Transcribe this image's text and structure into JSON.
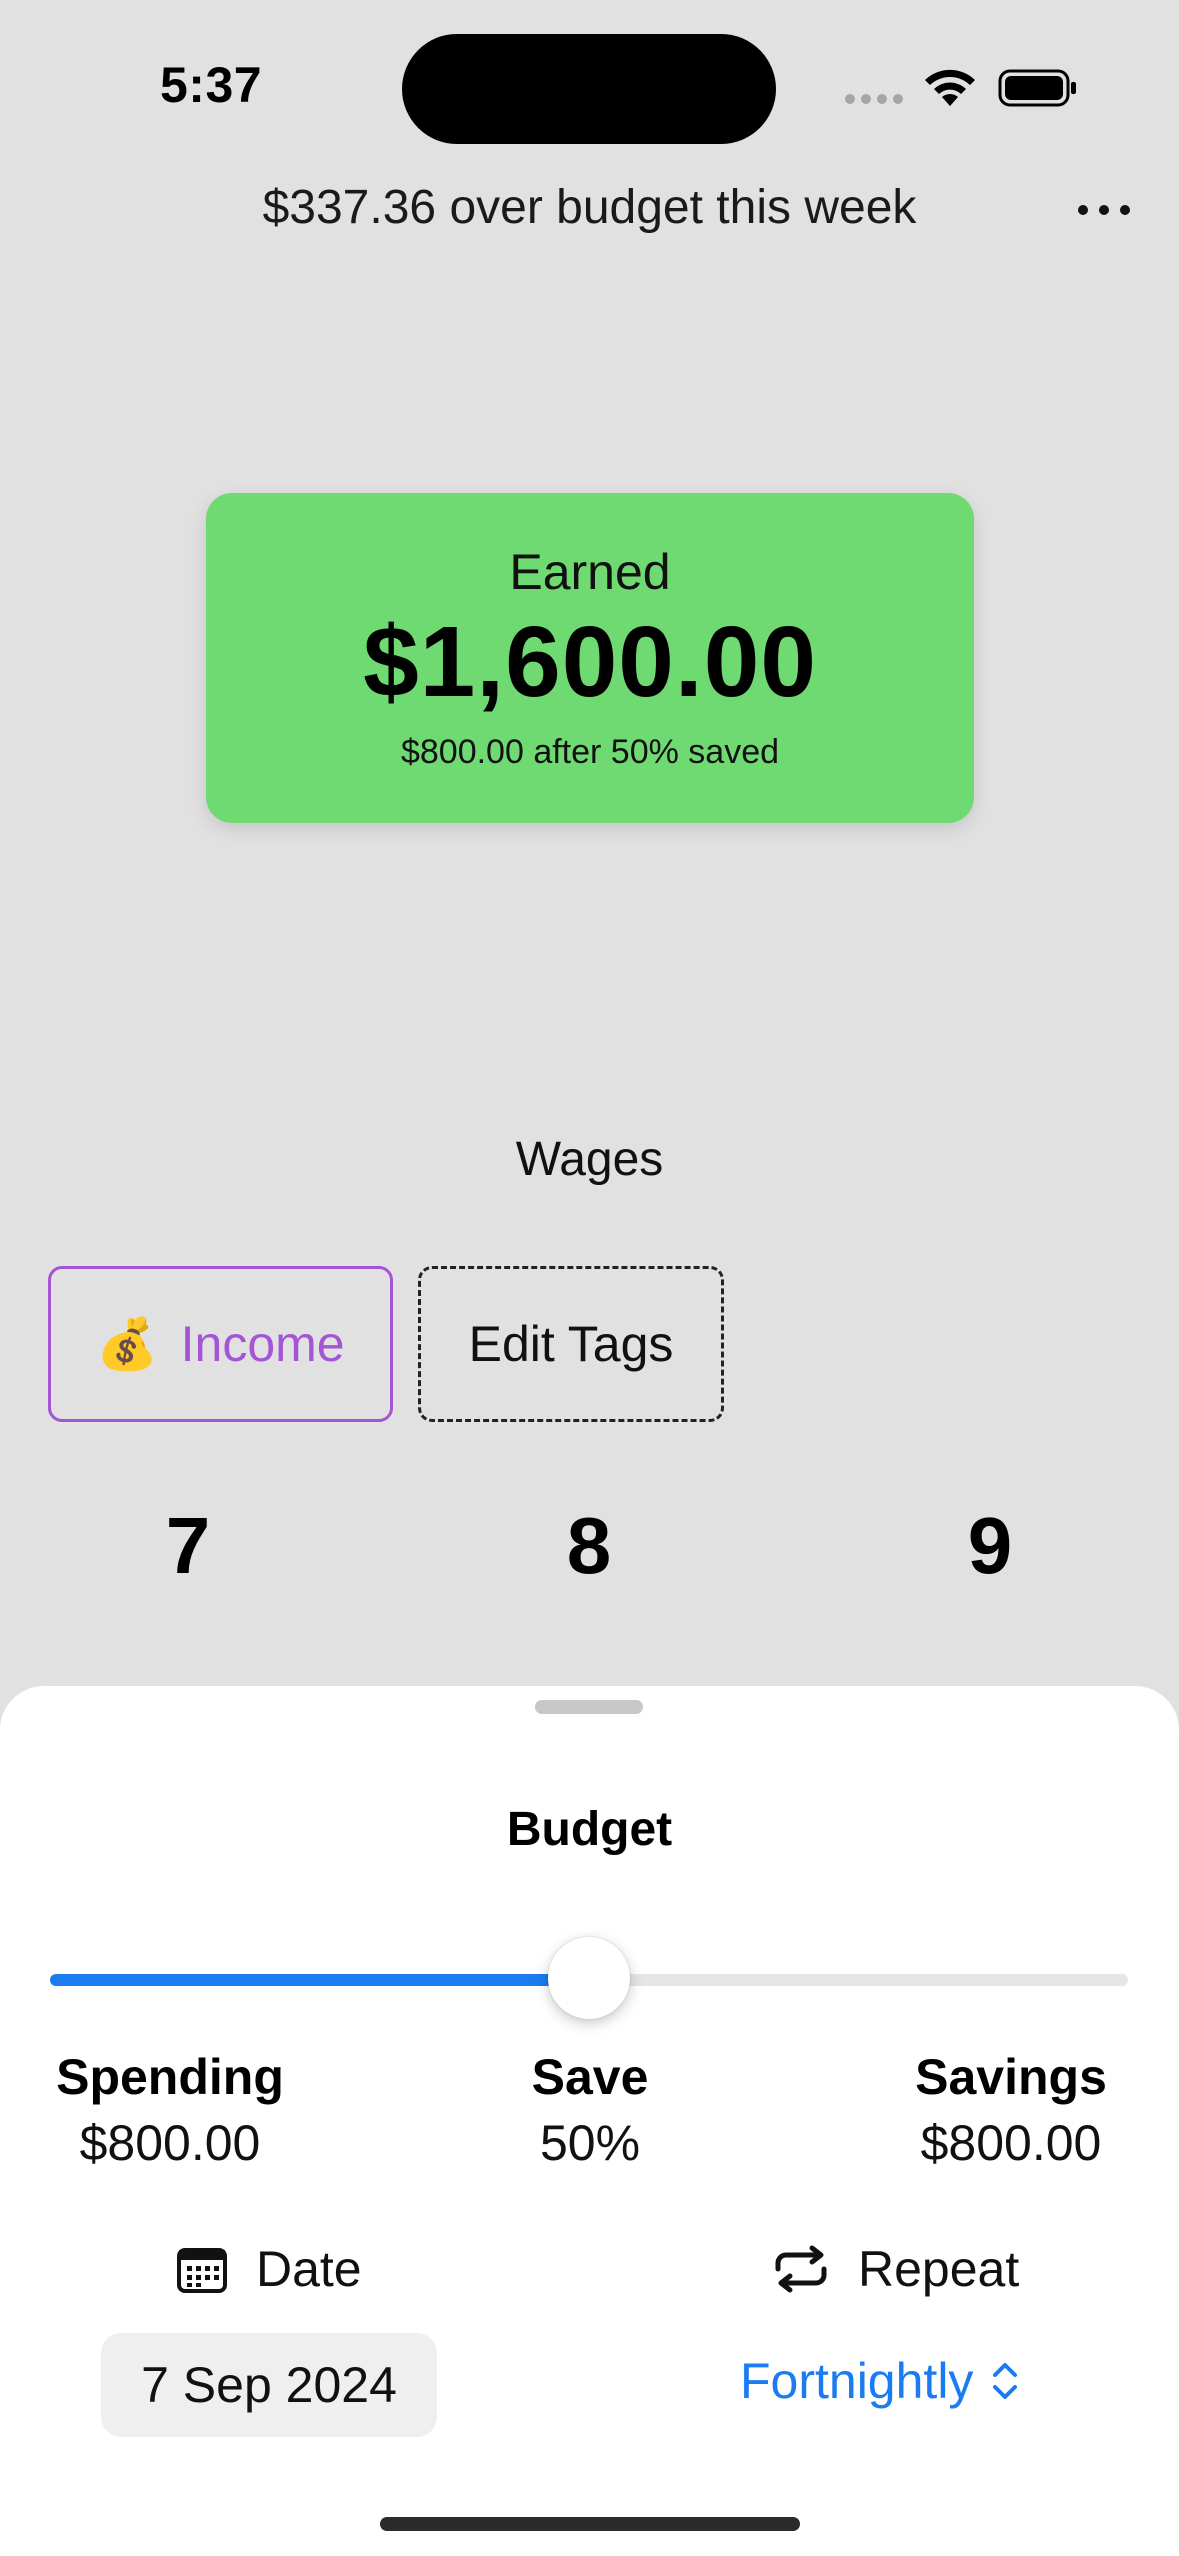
{
  "status_bar": {
    "time": "5:37"
  },
  "header": {
    "title": "$337.36 over budget this week"
  },
  "earned_card": {
    "label": "Earned",
    "amount": "$1,600.00",
    "subtitle": "$800.00 after 50% saved",
    "color": "#6fd972"
  },
  "category": {
    "label": "Wages"
  },
  "tags": {
    "income": {
      "emoji": "💰",
      "label": "Income",
      "color": "#a455d6"
    },
    "edit_label": "Edit Tags"
  },
  "keypad": {
    "digits": [
      "7",
      "8",
      "9"
    ]
  },
  "budget_sheet": {
    "title": "Budget",
    "slider": {
      "save_fraction": 0.5,
      "color": "#1a7cf0"
    },
    "spending": {
      "label": "Spending",
      "value": "$800.00"
    },
    "save": {
      "label": "Save",
      "value": "50%"
    },
    "savings": {
      "label": "Savings",
      "value": "$800.00"
    },
    "date": {
      "label": "Date",
      "value": "7 Sep 2024"
    },
    "repeat": {
      "label": "Repeat",
      "value": "Fortnightly"
    }
  }
}
